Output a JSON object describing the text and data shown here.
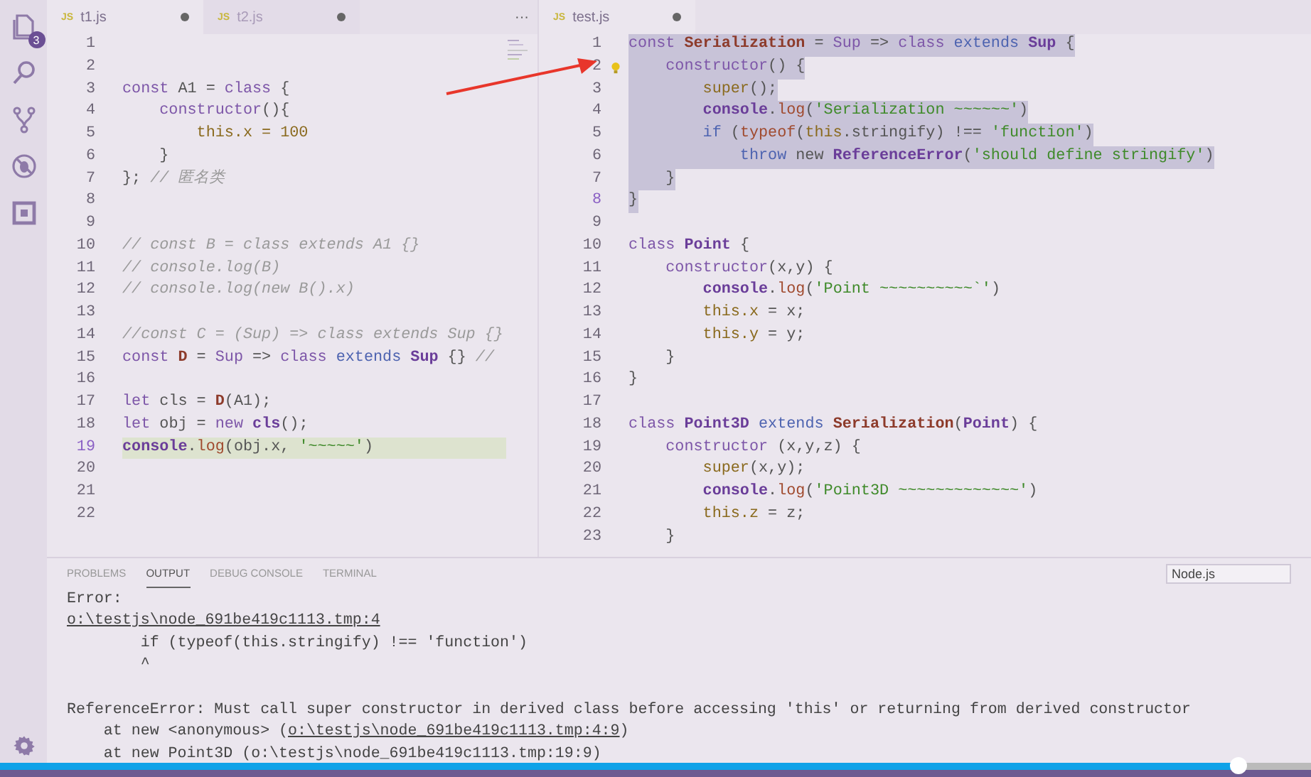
{
  "activity_bar": {
    "items": [
      {
        "kind": "files",
        "badge": "3"
      },
      {
        "kind": "search"
      },
      {
        "kind": "source-control"
      },
      {
        "kind": "debug"
      },
      {
        "kind": "extensions"
      }
    ],
    "bottom": [
      {
        "kind": "settings"
      }
    ]
  },
  "editor_groups": [
    {
      "tabs": [
        {
          "icon": "JS",
          "label": "t1.js",
          "selected": true,
          "dirty": true
        },
        {
          "icon": "JS",
          "label": "t2.js",
          "selected": false,
          "dirty": true
        }
      ],
      "more": "···",
      "minimap": true,
      "lines": [
        {
          "n": "1",
          "active": false
        },
        {
          "n": "2",
          "active": false
        },
        {
          "n": "3",
          "active": false,
          "highlighted": false,
          "tokens": [
            {
              "text": "const ",
              "kind": "kw"
            },
            {
              "text": "A1 = ",
              "kind": "p"
            },
            {
              "text": "class",
              "kind": "kw"
            },
            {
              "text": " {",
              "kind": "p"
            }
          ]
        },
        {
          "n": "4",
          "active": false,
          "highlighted": false,
          "tokens": [
            {
              "text": "    constructor",
              "kind": "kw"
            },
            {
              "text": "(){",
              "kind": "p"
            }
          ]
        },
        {
          "n": "5",
          "active": false,
          "highlighted": false,
          "tokens": [
            {
              "text": "        this.x = 100",
              "kind": "vr"
            }
          ]
        },
        {
          "n": "6",
          "active": false,
          "highlighted": false,
          "tokens": [
            {
              "text": "    }",
              "kind": "p"
            }
          ]
        },
        {
          "n": "7",
          "active": false,
          "highlighted": false,
          "tokens": [
            {
              "text": "}; ",
              "kind": "p"
            },
            {
              "text": "// 匿名类",
              "kind": "cm"
            }
          ]
        },
        {
          "n": "8",
          "active": false
        },
        {
          "n": "9",
          "active": false
        },
        {
          "n": "10",
          "active": false,
          "highlighted": false,
          "tokens": [
            {
              "text": "// const B = class extends A1 {}",
              "kind": "cm"
            }
          ]
        },
        {
          "n": "11",
          "active": false,
          "highlighted": false,
          "tokens": [
            {
              "text": "// console.log(B)",
              "kind": "cm"
            }
          ]
        },
        {
          "n": "12",
          "active": false,
          "highlighted": false,
          "tokens": [
            {
              "text": "// console.log(new B().x)",
              "kind": "cm"
            }
          ]
        },
        {
          "n": "13",
          "active": false
        },
        {
          "n": "14",
          "active": false,
          "highlighted": false,
          "tokens": [
            {
              "text": "//const C = (Sup) => class extends Sup {}",
              "kind": "cm"
            }
          ]
        },
        {
          "n": "15",
          "active": false,
          "highlighted": false,
          "tokens": [
            {
              "text": "const ",
              "kind": "kw"
            },
            {
              "text": "D",
              "kind": "ty"
            },
            {
              "text": " = ",
              "kind": "p"
            },
            {
              "text": "Sup",
              "kind": "kw"
            },
            {
              "text": " => ",
              "kind": "p"
            },
            {
              "text": "class ",
              "kind": "kw"
            },
            {
              "text": "extends ",
              "kind": "ctl"
            },
            {
              "text": "Sup",
              "kind": "ent"
            },
            {
              "text": " {} ",
              "kind": "p"
            },
            {
              "text": "//",
              "kind": "cm"
            }
          ]
        },
        {
          "n": "16",
          "active": false
        },
        {
          "n": "17",
          "active": false,
          "highlighted": false,
          "tokens": [
            {
              "text": "let ",
              "kind": "kw"
            },
            {
              "text": "cls = ",
              "kind": "p"
            },
            {
              "text": "D",
              "kind": "ty"
            },
            {
              "text": "(A1);",
              "kind": "p"
            }
          ]
        },
        {
          "n": "18",
          "active": false,
          "highlighted": false,
          "tokens": [
            {
              "text": "let ",
              "kind": "kw"
            },
            {
              "text": "obj = ",
              "kind": "p"
            },
            {
              "text": "new ",
              "kind": "kw"
            },
            {
              "text": "cls",
              "kind": "ent"
            },
            {
              "text": "();",
              "kind": "p"
            }
          ]
        },
        {
          "n": "19",
          "active": true,
          "highlighted": true,
          "tokens": [
            {
              "text": "console",
              "kind": "ent"
            },
            {
              "text": ".",
              "kind": "p"
            },
            {
              "text": "log",
              "kind": "fn"
            },
            {
              "text": "(obj.x, ",
              "kind": "p"
            },
            {
              "text": "'~~~~~'",
              "kind": "str"
            },
            {
              "text": ")",
              "kind": "p"
            }
          ]
        },
        {
          "n": "20",
          "active": false
        },
        {
          "n": "21",
          "active": false
        },
        {
          "n": "22",
          "active": false
        }
      ]
    },
    {
      "tabs": [
        {
          "icon": "JS",
          "label": "test.js",
          "selected": true,
          "dirty": true
        }
      ],
      "lines": [
        {
          "n": "1",
          "active": false,
          "selected": true,
          "tokens": [
            {
              "text": "const ",
              "kind": "kw"
            },
            {
              "text": "Serialization",
              "kind": "ty"
            },
            {
              "text": " = ",
              "kind": "p"
            },
            {
              "text": "Sup",
              "kind": "kw"
            },
            {
              "text": " => ",
              "kind": "p"
            },
            {
              "text": "class ",
              "kind": "kw"
            },
            {
              "text": "extends ",
              "kind": "ctl"
            },
            {
              "text": "Sup",
              "kind": "ent"
            },
            {
              "text": " {",
              "kind": "p"
            }
          ]
        },
        {
          "n": "2",
          "active": false,
          "selected": true,
          "lightbulb": true,
          "tokens": [
            {
              "text": "    constructor",
              "kind": "kw"
            },
            {
              "text": "() {",
              "kind": "p"
            }
          ]
        },
        {
          "n": "3",
          "active": false,
          "selected": true,
          "tokens": [
            {
              "text": "        super",
              "kind": "vr"
            },
            {
              "text": "();",
              "kind": "p"
            }
          ]
        },
        {
          "n": "4",
          "active": false,
          "selected": true,
          "tokens": [
            {
              "text": "        console",
              "kind": "ent"
            },
            {
              "text": ".",
              "kind": "p"
            },
            {
              "text": "log",
              "kind": "fn"
            },
            {
              "text": "(",
              "kind": "p"
            },
            {
              "text": "'Serialization ~~~~~~'",
              "kind": "str"
            },
            {
              "text": ")",
              "kind": "p"
            }
          ]
        },
        {
          "n": "5",
          "active": false,
          "selected": true,
          "tokens": [
            {
              "text": "        if ",
              "kind": "ctl"
            },
            {
              "text": "(",
              "kind": "p"
            },
            {
              "text": "typeof",
              "kind": "fn"
            },
            {
              "text": "(",
              "kind": "p"
            },
            {
              "text": "this",
              "kind": "vr"
            },
            {
              "text": ".stringify) !== ",
              "kind": "p"
            },
            {
              "text": "'function'",
              "kind": "str"
            },
            {
              "text": ")",
              "kind": "p"
            }
          ]
        },
        {
          "n": "6",
          "active": false,
          "selected": true,
          "tokens": [
            {
              "text": "            throw ",
              "kind": "ctl"
            },
            {
              "text": "new ",
              "kind": "p"
            },
            {
              "text": "ReferenceError",
              "kind": "ent"
            },
            {
              "text": "(",
              "kind": "p"
            },
            {
              "text": "'should define stringify'",
              "kind": "str"
            },
            {
              "text": ")",
              "kind": "p"
            }
          ]
        },
        {
          "n": "7",
          "active": false,
          "selected": true,
          "tokens": [
            {
              "text": "    }",
              "kind": "p"
            }
          ]
        },
        {
          "n": "8",
          "active": true,
          "selected": true,
          "tokens": [
            {
              "text": "}",
              "kind": "p"
            }
          ]
        },
        {
          "n": "9",
          "active": false
        },
        {
          "n": "10",
          "active": false,
          "selected": false,
          "tokens": [
            {
              "text": "class ",
              "kind": "kw"
            },
            {
              "text": "Point",
              "kind": "ent"
            },
            {
              "text": " {",
              "kind": "p"
            }
          ]
        },
        {
          "n": "11",
          "active": false,
          "selected": false,
          "tokens": [
            {
              "text": "    constructor",
              "kind": "kw"
            },
            {
              "text": "(x,y) {",
              "kind": "p"
            }
          ]
        },
        {
          "n": "12",
          "active": false,
          "selected": false,
          "tokens": [
            {
              "text": "        console",
              "kind": "ent"
            },
            {
              "text": ".",
              "kind": "p"
            },
            {
              "text": "log",
              "kind": "fn"
            },
            {
              "text": "(",
              "kind": "p"
            },
            {
              "text": "'Point ~~~~~~~~~~`'",
              "kind": "str"
            },
            {
              "text": ")",
              "kind": "p"
            }
          ]
        },
        {
          "n": "13",
          "active": false,
          "selected": false,
          "tokens": [
            {
              "text": "        this.x",
              "kind": "vr"
            },
            {
              "text": " = x;",
              "kind": "p"
            }
          ]
        },
        {
          "n": "14",
          "active": false,
          "selected": false,
          "tokens": [
            {
              "text": "        this.y",
              "kind": "vr"
            },
            {
              "text": " = y;",
              "kind": "p"
            }
          ]
        },
        {
          "n": "15",
          "active": false,
          "selected": false,
          "tokens": [
            {
              "text": "    }",
              "kind": "p"
            }
          ]
        },
        {
          "n": "16",
          "active": false,
          "selected": false,
          "tokens": [
            {
              "text": "}",
              "kind": "p"
            }
          ]
        },
        {
          "n": "17",
          "active": false
        },
        {
          "n": "18",
          "active": false,
          "selected": false,
          "tokens": [
            {
              "text": "class ",
              "kind": "kw"
            },
            {
              "text": "Point3D ",
              "kind": "ent"
            },
            {
              "text": "extends ",
              "kind": "ctl"
            },
            {
              "text": "Serialization",
              "kind": "ty"
            },
            {
              "text": "(",
              "kind": "p"
            },
            {
              "text": "Point",
              "kind": "ent"
            },
            {
              "text": ") {",
              "kind": "p"
            }
          ]
        },
        {
          "n": "19",
          "active": false,
          "selected": false,
          "tokens": [
            {
              "text": "    constructor ",
              "kind": "kw"
            },
            {
              "text": "(x,y,z) {",
              "kind": "p"
            }
          ]
        },
        {
          "n": "20",
          "active": false,
          "selected": false,
          "tokens": [
            {
              "text": "        super",
              "kind": "vr"
            },
            {
              "text": "(x,y);",
              "kind": "p"
            }
          ]
        },
        {
          "n": "21",
          "active": false,
          "selected": false,
          "tokens": [
            {
              "text": "        console",
              "kind": "ent"
            },
            {
              "text": ".",
              "kind": "p"
            },
            {
              "text": "log",
              "kind": "fn"
            },
            {
              "text": "(",
              "kind": "p"
            },
            {
              "text": "'Point3D ~~~~~~~~~~~~~'",
              "kind": "str"
            },
            {
              "text": ")",
              "kind": "p"
            }
          ]
        },
        {
          "n": "22",
          "active": false,
          "selected": false,
          "tokens": [
            {
              "text": "        this.z",
              "kind": "vr"
            },
            {
              "text": " = z;",
              "kind": "p"
            }
          ]
        },
        {
          "n": "23",
          "active": false,
          "selected": false,
          "tokens": [
            {
              "text": "    }",
              "kind": "p"
            }
          ]
        }
      ]
    }
  ],
  "panel": {
    "tabs": [
      {
        "label": "PROBLEMS",
        "selected": false
      },
      {
        "label": "OUTPUT",
        "selected": true
      },
      {
        "label": "DEBUG CONSOLE",
        "selected": false
      },
      {
        "label": "TERMINAL",
        "selected": false
      }
    ],
    "dropdown": "Node.js",
    "output": [
      {
        "kind": "text",
        "segments": [
          {
            "text": "Error:",
            "link": false
          }
        ]
      },
      {
        "kind": "text",
        "segments": [
          {
            "text": "o:\\testjs\\node_691be419c1113.tmp:4",
            "link": true
          }
        ]
      },
      {
        "kind": "text",
        "segments": [
          {
            "text": "        if (typeof(this.stringify) !== 'function')",
            "link": false
          }
        ]
      },
      {
        "kind": "text",
        "segments": [
          {
            "text": "        ^",
            "link": false
          }
        ]
      },
      {
        "kind": "blank"
      },
      {
        "kind": "text",
        "segments": [
          {
            "text": "ReferenceError: Must call super constructor in derived class before accessing 'this' or returning from derived constructor",
            "link": false
          }
        ]
      },
      {
        "kind": "text",
        "segments": [
          {
            "text": "    at new <anonymous> (",
            "link": false
          },
          {
            "text": "o:\\testjs\\node_691be419c1113.tmp:4:9",
            "link": true
          },
          {
            "text": ")",
            "link": false
          }
        ]
      },
      {
        "kind": "text",
        "segments": [
          {
            "text": "    at new Point3D (o:\\testjs\\node_691be419c1113.tmp:19:9)",
            "link": false
          }
        ]
      }
    ]
  },
  "video_progress": {
    "level": 0.945
  }
}
